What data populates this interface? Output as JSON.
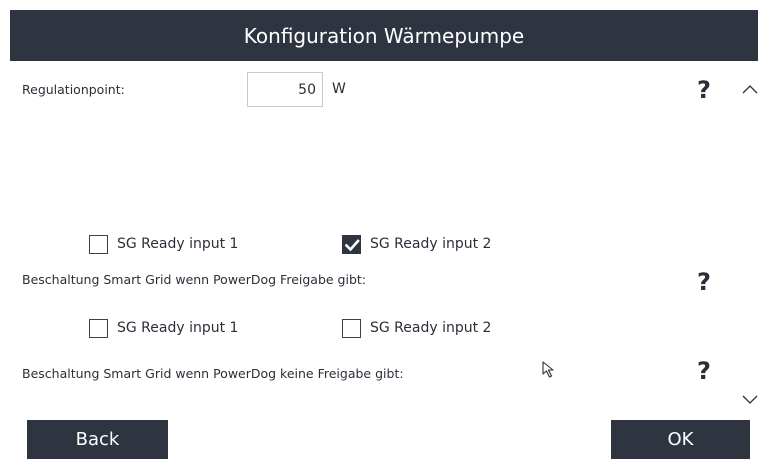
{
  "header": {
    "title": "Konfiguration Wärmepumpe"
  },
  "regulation": {
    "label": "Regulationpoint:",
    "value": "50",
    "unit": "W",
    "help": "?"
  },
  "group_freigabe": {
    "checkboxes": [
      {
        "label": "SG Ready input 1",
        "checked": false
      },
      {
        "label": "SG Ready input 2",
        "checked": true
      }
    ],
    "label": "Beschaltung Smart Grid wenn PowerDog Freigabe gibt:",
    "help": "?"
  },
  "group_keine_freigabe": {
    "checkboxes": [
      {
        "label": "SG Ready input 1",
        "checked": false
      },
      {
        "label": "SG Ready input 2",
        "checked": false
      }
    ],
    "label": "Beschaltung Smart Grid wenn PowerDog keine Freigabe gibt:",
    "help": "?"
  },
  "footer": {
    "back_label": "Back",
    "ok_label": "OK"
  },
  "icons": {
    "scroll_up": "chevron-up-icon",
    "scroll_down": "chevron-down-icon",
    "cursor": "mouse-pointer-icon",
    "check": "checkmark-icon"
  },
  "colors": {
    "header_bg": "#2e3440",
    "button_bg": "#2e3440",
    "text": "#2b2f38"
  }
}
